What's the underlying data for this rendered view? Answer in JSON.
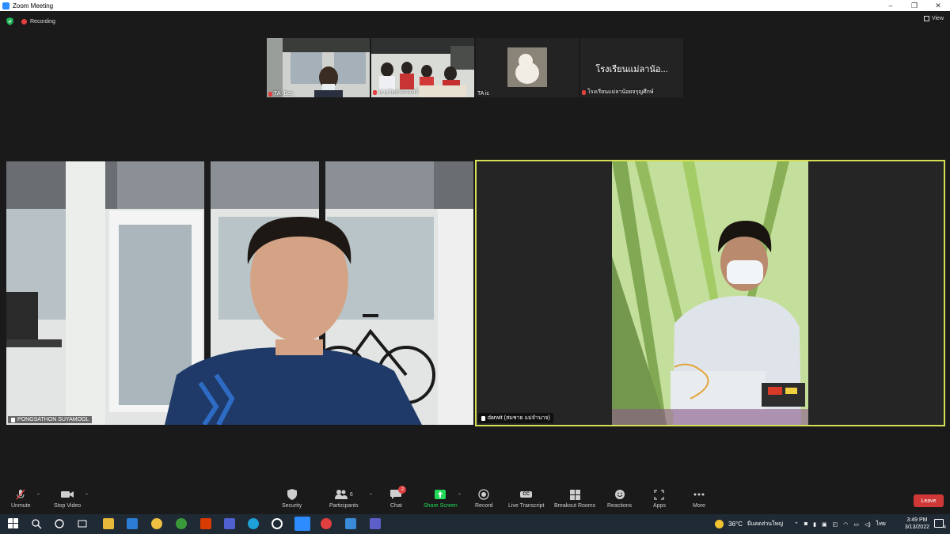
{
  "window": {
    "title": "Zoom Meeting",
    "minimize": "–",
    "maximize": "❐",
    "close": "✕"
  },
  "meeting": {
    "recording_label": "Recording",
    "view_label": "View"
  },
  "thumbnails": [
    {
      "name": "TA_Bas",
      "muted": true
    },
    {
      "name": "ปายวิทยาศาสตร์",
      "muted": true
    },
    {
      "name": "TA ic",
      "muted": false
    },
    {
      "name": "โรงเรียนแม่ลาน้อยจรุญศึกษ์",
      "display_name": "โรงเรียนแม่ลาน้อ...",
      "muted": true
    }
  ],
  "main_videos": [
    {
      "name": "PONGSATHON SUYAMOOL"
    },
    {
      "name": "darwit (สมชาย แม่จำนาจ)",
      "active_speaker": true
    }
  ],
  "toolbar": {
    "unmute": "Unmute",
    "stop_video": "Stop Video",
    "security": "Security",
    "participants": "Participants",
    "participants_count": "6",
    "chat": "Chat",
    "chat_badge": "2",
    "share_screen": "Share Screen",
    "record": "Record",
    "live_transcript": "Live Transcript",
    "cc": "CC",
    "breakout_rooms": "Breakout Rooms",
    "reactions": "Reactions",
    "apps": "Apps",
    "more": "More",
    "leave": "Leave"
  },
  "taskbar": {
    "weather": "36°C",
    "weather_desc": "มีแดดส่วนใหญ่",
    "language": "ไทย",
    "time": "3:49 PM",
    "date": "3/13/2022",
    "notif_count": "4"
  },
  "colors": {
    "accent": "#2d8cff",
    "share": "#23d959",
    "leave": "#d03838",
    "speaker_border": "#d4df55"
  }
}
